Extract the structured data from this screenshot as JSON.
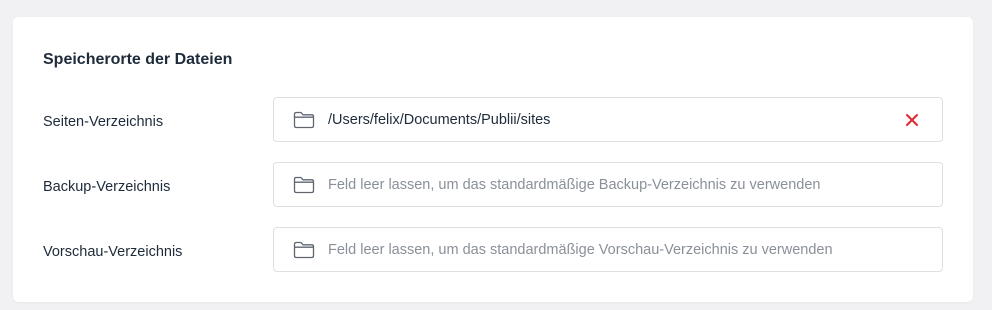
{
  "section": {
    "title": "Speicherorte der Dateien"
  },
  "rows": [
    {
      "label": "Seiten-Verzeichnis",
      "value": "/Users/felix/Documents/Publii/sites",
      "placeholder": "",
      "icon": "folder-icon",
      "clear_icon": "close-icon"
    },
    {
      "label": "Backup-Verzeichnis",
      "value": "",
      "placeholder": "Feld leer lassen, um das standardmäßige Backup-Verzeichnis zu verwenden",
      "icon": "folder-icon"
    },
    {
      "label": "Vorschau-Verzeichnis",
      "value": "",
      "placeholder": "Feld leer lassen, um das standardmäßige Vorschau-Verzeichnis zu verwenden",
      "icon": "folder-icon"
    }
  ],
  "colors": {
    "text": "#1e2b3a",
    "placeholder": "#8a9099",
    "border": "#dcdfe4",
    "clear": "#e5262f",
    "background": "#f1f1f3",
    "card": "#ffffff"
  }
}
